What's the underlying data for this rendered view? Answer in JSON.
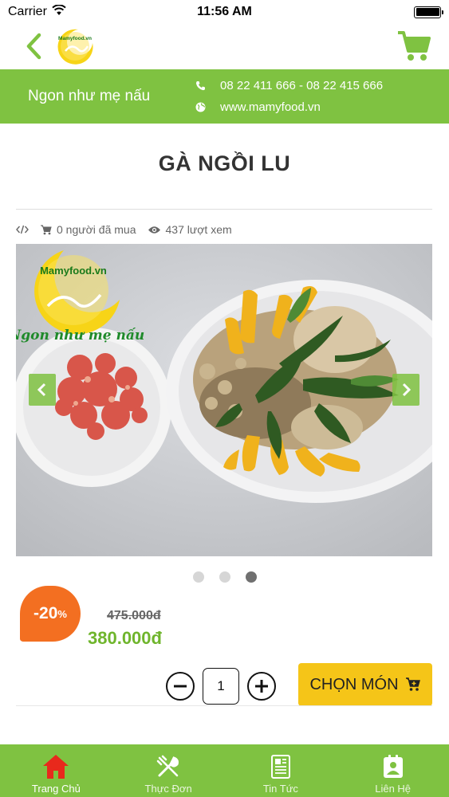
{
  "status_bar": {
    "carrier": "Carrier",
    "time": "11:56 AM"
  },
  "header": {
    "logo_text": "Mamyfood.vn"
  },
  "banner": {
    "slogan": "Ngon như mẹ nấu",
    "phone": "08 22 411 666 - 08 22 415 666",
    "website": "www.mamyfood.vn"
  },
  "product": {
    "title": "GÀ NGỒI LU",
    "buyers": "0 người đã mua",
    "views": "437 lượt xem",
    "discount": "-20",
    "discount_suffix": "%",
    "old_price": "475.000đ",
    "new_price": "380.000đ",
    "quantity": "1",
    "order_button": "CHỌN MÓN"
  },
  "gallery": {
    "watermark_brand": "Mamyfood.vn",
    "watermark_slogan": "Ngon như mẹ nấu",
    "slide_count": 3,
    "active_slide": 3
  },
  "tabs": [
    {
      "label": "Trang Chủ",
      "icon": "home-icon",
      "active": true
    },
    {
      "label": "Thực Đơn",
      "icon": "utensils-icon",
      "active": false
    },
    {
      "label": "Tin Tức",
      "icon": "news-icon",
      "active": false
    },
    {
      "label": "Liên Hệ",
      "icon": "contact-icon",
      "active": false
    }
  ],
  "colors": {
    "brand_green": "#7fc241",
    "price_green": "#6fb52c",
    "discount_orange": "#f36f21",
    "order_yellow": "#f5c518",
    "home_red": "#e8291c"
  }
}
